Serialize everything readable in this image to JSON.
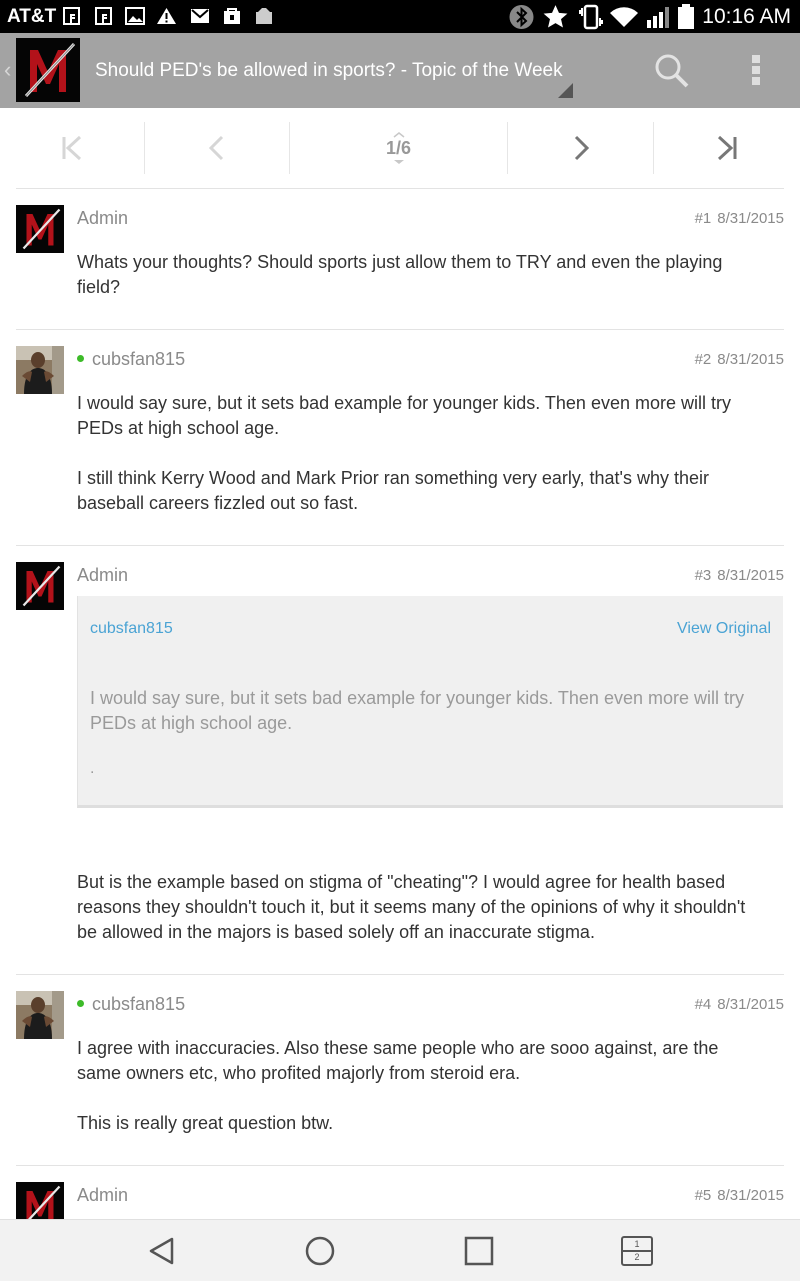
{
  "status_bar": {
    "carrier": "AT&T",
    "time": "10:16 AM",
    "left_icons": [
      "facebook-icon",
      "facebook-icon",
      "image-icon",
      "warning-icon",
      "gmail-icon",
      "store-icon",
      "app-icon"
    ],
    "right_icons": [
      "bluetooth-icon",
      "star-icon",
      "vibrate-icon",
      "wifi-icon",
      "signal-icon",
      "battery-icon"
    ]
  },
  "action_bar": {
    "title": "Should PED's be allowed in sports? - Topic of the Week",
    "background": "#a3a3a3"
  },
  "pager": {
    "page_label": "1/6",
    "current_page": 1,
    "total_pages": 6,
    "buttons": [
      "first-page",
      "previous-page",
      "next-page",
      "last-page"
    ]
  },
  "posts": [
    {
      "author": "Admin",
      "online": false,
      "number": "#1",
      "date": "8/31/2015",
      "paragraphs": [
        "Whats your thoughts? Should sports just allow them to TRY and even the playing field?"
      ]
    },
    {
      "author": "cubsfan815",
      "online": true,
      "number": "#2",
      "date": "8/31/2015",
      "paragraphs": [
        "I would say sure, but it sets bad example for younger kids. Then even more will try PEDs at high school age.",
        "I still think Kerry Wood and Mark Prior ran something very early, that's why their baseball careers fizzled out so fast."
      ]
    },
    {
      "author": "Admin",
      "online": false,
      "number": "#3",
      "date": "8/31/2015",
      "quote": {
        "author": "cubsfan815",
        "view_label": "View Original",
        "text": "I would say sure, but it sets bad example for younger kids. Then even more will try PEDs at high school age.",
        "trailing": "."
      },
      "paragraphs": [
        "But is the example based on stigma of \"cheating\"? I would agree for health based reasons they shouldn't touch it, but it seems many of the opinions of why it shouldn't be allowed in the majors is based solely off an inaccurate stigma."
      ]
    },
    {
      "author": "cubsfan815",
      "online": true,
      "number": "#4",
      "date": "8/31/2015",
      "paragraphs": [
        "I agree with inaccuracies. Also these same people who are sooo against, are the same owners etc, who profited majorly from steroid era.",
        "This is really great question btw."
      ]
    },
    {
      "author": "Admin",
      "online": false,
      "number": "#5",
      "date": "8/31/2015",
      "paragraphs": []
    }
  ],
  "nav_bar": {
    "buttons": [
      "back-icon",
      "home-icon",
      "recents-icon",
      "dual-window-icon"
    ],
    "dual_window_digits": [
      "1",
      "2"
    ]
  },
  "colors": {
    "link": "#4aa3d4",
    "online": "#3dbb29",
    "meta_text": "#8a8a8a",
    "body_text": "#333333"
  }
}
